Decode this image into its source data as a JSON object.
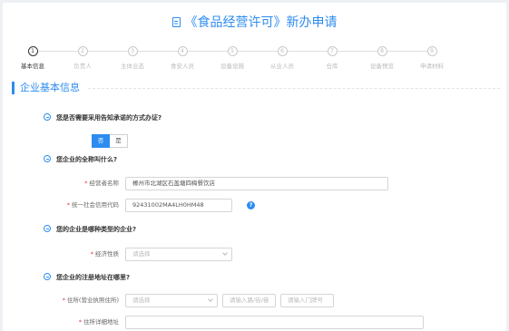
{
  "title": "《食品经营许可》新办申请",
  "steps": [
    {
      "num": "1",
      "label": "基本信息",
      "active": true
    },
    {
      "num": "2",
      "label": "负责人",
      "active": false
    },
    {
      "num": "3",
      "label": "主体业态",
      "active": false
    },
    {
      "num": "4",
      "label": "食安人员",
      "active": false
    },
    {
      "num": "5",
      "label": "设备设施",
      "active": false
    },
    {
      "num": "6",
      "label": "从业人员",
      "active": false
    },
    {
      "num": "7",
      "label": "仓库",
      "active": false
    },
    {
      "num": "8",
      "label": "设备预览",
      "active": false
    },
    {
      "num": "9",
      "label": "申请材料",
      "active": false
    }
  ],
  "section_title": "企业基本信息",
  "questions": {
    "q1": "您是否需要采用告知承诺的方式办证?",
    "q2": "您企业的全称叫什么?",
    "q3": "您的企业是哪种类型的企业?",
    "q4": "您企业的注册地址在哪里?"
  },
  "toggle": {
    "no": "否",
    "yes": "是",
    "selected": "no"
  },
  "fields": {
    "operator_name_label": "经营者名称",
    "operator_name_value": "郴州市北湖区石盖塘四梅餐饮店",
    "credit_code_label": "统一社会信用代码",
    "credit_code_value": "92431002MA4LH0HM48",
    "economic_nature_label": "经济性质",
    "economic_nature_placeholder": "请选择",
    "residence_label": "住所(营业执照住所)",
    "residence_select_placeholder": "请选择",
    "street_placeholder": "请输入路/街/巷",
    "house_no_placeholder": "请输入门牌号",
    "address_detail_label": "住所详细地址",
    "address_detail_value": ""
  },
  "help_icon_glyph": "?",
  "colors": {
    "accent": "#2d8cf0",
    "required": "#e4393c"
  }
}
